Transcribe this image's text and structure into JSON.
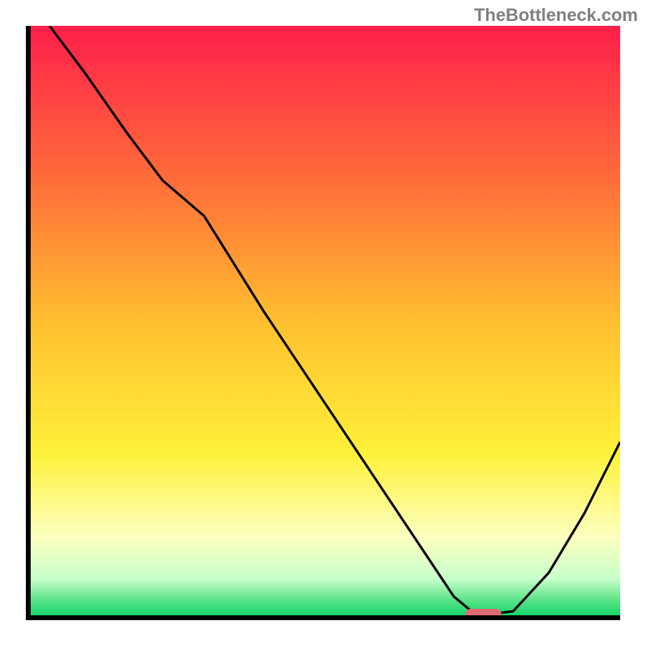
{
  "watermark": "TheBottleneck.com",
  "chart_data": {
    "type": "line",
    "title": "",
    "xlabel": "",
    "ylabel": "",
    "xlim": [
      0,
      100
    ],
    "ylim": [
      0,
      100
    ],
    "series": [
      {
        "name": "curve",
        "x": [
          4,
          10,
          17,
          23,
          30,
          40,
          50,
          60,
          68,
          72,
          75,
          78,
          82,
          88,
          94,
          100
        ],
        "y": [
          100,
          92,
          82,
          74,
          68,
          52,
          37,
          22,
          10,
          4,
          1.5,
          1,
          1.5,
          8,
          18,
          30
        ]
      }
    ],
    "marker": {
      "name": "optimal-region",
      "x_center": 77,
      "y": 1,
      "width": 6,
      "height": 1.8,
      "color": "#e06b74"
    },
    "gradient_stops": [
      {
        "offset": 0.0,
        "color": "#ff1f4b"
      },
      {
        "offset": 0.25,
        "color": "#ff6a3a"
      },
      {
        "offset": 0.5,
        "color": "#ffbf2f"
      },
      {
        "offset": 0.72,
        "color": "#fff23a"
      },
      {
        "offset": 0.86,
        "color": "#fcffbf"
      },
      {
        "offset": 0.93,
        "color": "#c8ffca"
      },
      {
        "offset": 0.965,
        "color": "#5fe48a"
      },
      {
        "offset": 1.0,
        "color": "#00d060"
      }
    ]
  }
}
